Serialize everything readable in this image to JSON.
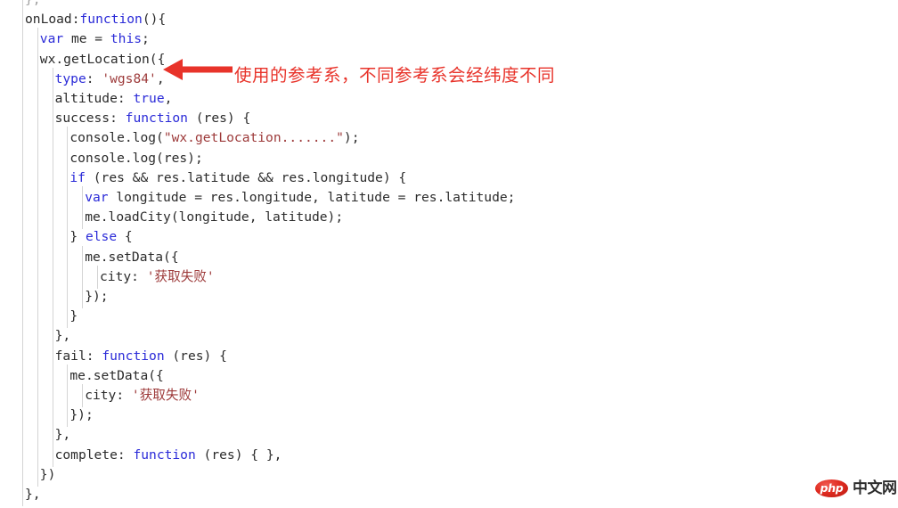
{
  "editor": {
    "background_color": "#ffffff",
    "text_color": "#2b2b2b",
    "keyword_color": "#2b2bd8",
    "string_color": "#9d3a3a",
    "guide_color": "#d4d4d4",
    "font_size_px": 14.6,
    "line_height_px": 22.2,
    "language": "javascript"
  },
  "code": {
    "lines": [
      {
        "indent": 0,
        "segments": [
          {
            "t": "},",
            "c": "pl"
          }
        ],
        "clipped": true
      },
      {
        "indent": 0,
        "segments": [
          {
            "t": "onLoad:",
            "c": "pl"
          },
          {
            "t": "function",
            "c": "kw"
          },
          {
            "t": "(){",
            "c": "pl"
          }
        ]
      },
      {
        "indent": 1,
        "segments": [
          {
            "t": "var",
            "c": "kw"
          },
          {
            "t": " me = ",
            "c": "pl"
          },
          {
            "t": "this",
            "c": "kw"
          },
          {
            "t": ";",
            "c": "pl"
          }
        ]
      },
      {
        "indent": 1,
        "segments": [
          {
            "t": "wx.getLocation({",
            "c": "pl"
          }
        ]
      },
      {
        "indent": 2,
        "segments": [
          {
            "t": "type",
            "c": "prop"
          },
          {
            "t": ": ",
            "c": "pl"
          },
          {
            "t": "'wgs84'",
            "c": "str"
          },
          {
            "t": ",",
            "c": "pl"
          }
        ]
      },
      {
        "indent": 2,
        "segments": [
          {
            "t": "altitude: ",
            "c": "pl"
          },
          {
            "t": "true",
            "c": "kw"
          },
          {
            "t": ",",
            "c": "pl"
          }
        ]
      },
      {
        "indent": 2,
        "segments": [
          {
            "t": "success: ",
            "c": "pl"
          },
          {
            "t": "function",
            "c": "kw"
          },
          {
            "t": " (res) {",
            "c": "pl"
          }
        ]
      },
      {
        "indent": 3,
        "segments": [
          {
            "t": "console.log(",
            "c": "pl"
          },
          {
            "t": "\"wx.getLocation.......\"",
            "c": "str"
          },
          {
            "t": ");",
            "c": "pl"
          }
        ]
      },
      {
        "indent": 3,
        "segments": [
          {
            "t": "console.log(res);",
            "c": "pl"
          }
        ]
      },
      {
        "indent": 3,
        "segments": [
          {
            "t": "if",
            "c": "kw"
          },
          {
            "t": " (res && res.latitude && res.longitude) {",
            "c": "pl"
          }
        ]
      },
      {
        "indent": 4,
        "segments": [
          {
            "t": "var",
            "c": "kw"
          },
          {
            "t": " longitude = res.longitude, latitude = res.latitude;",
            "c": "pl"
          }
        ]
      },
      {
        "indent": 4,
        "segments": [
          {
            "t": "me.loadCity(longitude, latitude);",
            "c": "pl"
          }
        ]
      },
      {
        "indent": 3,
        "segments": [
          {
            "t": "} ",
            "c": "pl"
          },
          {
            "t": "else",
            "c": "kw"
          },
          {
            "t": " {",
            "c": "pl"
          }
        ]
      },
      {
        "indent": 4,
        "segments": [
          {
            "t": "me.setData({",
            "c": "pl"
          }
        ]
      },
      {
        "indent": 5,
        "segments": [
          {
            "t": "city: ",
            "c": "pl"
          },
          {
            "t": "'获取失败'",
            "c": "str"
          }
        ]
      },
      {
        "indent": 4,
        "segments": [
          {
            "t": "});",
            "c": "pl"
          }
        ]
      },
      {
        "indent": 3,
        "segments": [
          {
            "t": "}",
            "c": "pl"
          }
        ]
      },
      {
        "indent": 2,
        "segments": [
          {
            "t": "},",
            "c": "pl"
          }
        ]
      },
      {
        "indent": 2,
        "segments": [
          {
            "t": "fail: ",
            "c": "pl"
          },
          {
            "t": "function",
            "c": "kw"
          },
          {
            "t": " (res) {",
            "c": "pl"
          }
        ]
      },
      {
        "indent": 3,
        "segments": [
          {
            "t": "me.setData({",
            "c": "pl"
          }
        ]
      },
      {
        "indent": 4,
        "segments": [
          {
            "t": "city: ",
            "c": "pl"
          },
          {
            "t": "'获取失败'",
            "c": "str"
          }
        ]
      },
      {
        "indent": 3,
        "segments": [
          {
            "t": "});",
            "c": "pl"
          }
        ]
      },
      {
        "indent": 2,
        "segments": [
          {
            "t": "},",
            "c": "pl"
          }
        ]
      },
      {
        "indent": 2,
        "segments": [
          {
            "t": "complete: ",
            "c": "pl"
          },
          {
            "t": "function",
            "c": "kw"
          },
          {
            "t": " (res) { },",
            "c": "pl"
          }
        ]
      },
      {
        "indent": 1,
        "segments": [
          {
            "t": "})",
            "c": "pl"
          }
        ]
      },
      {
        "indent": 0,
        "segments": [
          {
            "t": "},",
            "c": "pl"
          }
        ]
      }
    ]
  },
  "annotation": {
    "text": "使用的参考系，不同参考系会经纬度不同",
    "color": "#e8332a",
    "arrow_direction": "left",
    "arrow_color": "#e8332a"
  },
  "watermark": {
    "badge_text": "php",
    "label_text": "中文网",
    "badge_color": "#e02b20",
    "label_color": "#2d2d2d"
  }
}
